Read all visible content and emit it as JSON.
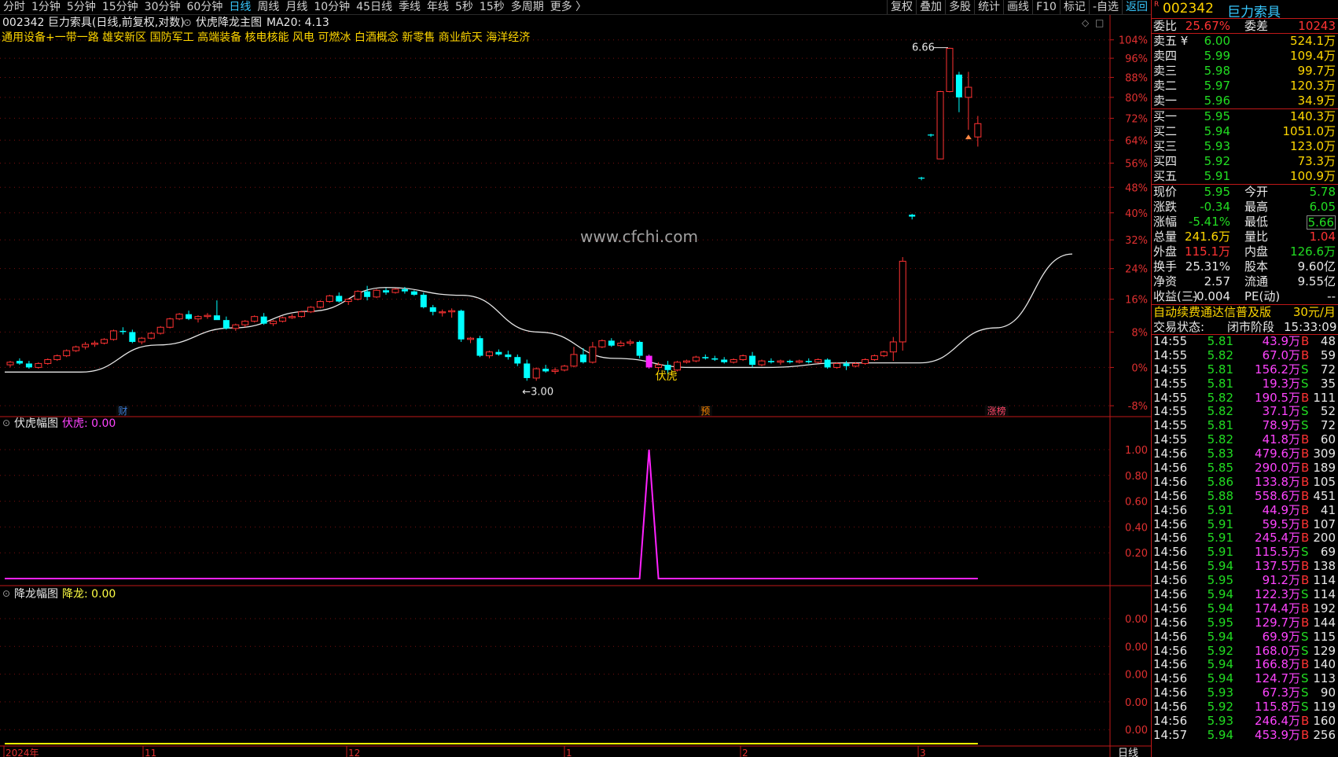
{
  "toolbar": {
    "periods": [
      "分时",
      "1分钟",
      "5分钟",
      "15分钟",
      "30分钟",
      "60分钟",
      "日线",
      "周线",
      "月线",
      "10分钟",
      "45日线",
      "季线",
      "年线",
      "5秒",
      "15秒",
      "多周期",
      "更多 〉"
    ],
    "active_period": "日线",
    "tools": [
      "复权",
      "叠加",
      "多股",
      "统计",
      "画线",
      "F10",
      "标记",
      "-自选",
      "返回"
    ]
  },
  "main_chart": {
    "title": "002342 巨力索具(日线,前复权,对数)",
    "indicator_name": "伏虎降龙主图",
    "ma_text": "MA20: 4.13",
    "concepts": "通用设备+一带一路 雄安新区 国防军工 高端装备 核电核能 风电 可燃冰 白酒概念 新零售 商业航天 海洋经济",
    "watermark": "www.cfchi.com",
    "annotations": {
      "high": "6.66",
      "low": "3.00",
      "signal": "伏虎"
    },
    "markers": [
      "财",
      "预",
      "涨榜"
    ],
    "y_ticks": [
      "104%",
      "96%",
      "88%",
      "80%",
      "72%",
      "64%",
      "56%",
      "48%",
      "40%",
      "32%",
      "24%",
      "16%",
      "8%",
      "0%",
      "-8%"
    ]
  },
  "sub_chart_1": {
    "title": "伏虎幅图",
    "value_text": "伏虎: 0.00",
    "y_ticks": [
      "1.00",
      "0.80",
      "0.60",
      "0.40",
      "0.20"
    ]
  },
  "sub_chart_2": {
    "title": "降龙幅图",
    "value_text": "降龙: 0.00",
    "y_ticks": [
      "0.00",
      "0.00",
      "0.00",
      "0.00",
      "0.00"
    ]
  },
  "time_axis": {
    "labels": [
      "2024年",
      "11",
      "12",
      "1",
      "2",
      "3"
    ],
    "unit": "日线"
  },
  "chart_data": {
    "type": "candlestick",
    "scale": "log",
    "pct_base": 3.5,
    "y_range_pct": [
      -10,
      106
    ],
    "candles": [
      [
        3.52,
        3.55,
        3.5,
        3.54
      ],
      [
        3.55,
        3.57,
        3.52,
        3.53
      ],
      [
        3.53,
        3.55,
        3.49,
        3.5
      ],
      [
        3.5,
        3.54,
        3.49,
        3.53
      ],
      [
        3.53,
        3.57,
        3.52,
        3.56
      ],
      [
        3.56,
        3.6,
        3.55,
        3.59
      ],
      [
        3.59,
        3.64,
        3.58,
        3.63
      ],
      [
        3.63,
        3.67,
        3.62,
        3.66
      ],
      [
        3.66,
        3.7,
        3.64,
        3.68
      ],
      [
        3.68,
        3.71,
        3.66,
        3.69
      ],
      [
        3.69,
        3.73,
        3.68,
        3.72
      ],
      [
        3.72,
        3.8,
        3.71,
        3.79
      ],
      [
        3.79,
        3.82,
        3.76,
        3.78
      ],
      [
        3.78,
        3.8,
        3.69,
        3.7
      ],
      [
        3.7,
        3.74,
        3.68,
        3.73
      ],
      [
        3.73,
        3.78,
        3.72,
        3.77
      ],
      [
        3.77,
        3.83,
        3.76,
        3.82
      ],
      [
        3.82,
        3.9,
        3.81,
        3.89
      ],
      [
        3.89,
        3.94,
        3.88,
        3.93
      ],
      [
        3.93,
        3.96,
        3.88,
        3.89
      ],
      [
        3.89,
        3.92,
        3.86,
        3.91
      ],
      [
        3.91,
        3.94,
        3.89,
        3.92
      ],
      [
        3.92,
        4.05,
        3.91,
        3.88
      ],
      [
        3.88,
        3.91,
        3.8,
        3.81
      ],
      [
        3.81,
        3.85,
        3.79,
        3.84
      ],
      [
        3.84,
        3.88,
        3.82,
        3.87
      ],
      [
        3.87,
        3.92,
        3.86,
        3.91
      ],
      [
        3.91,
        3.94,
        3.84,
        3.85
      ],
      [
        3.85,
        3.88,
        3.83,
        3.87
      ],
      [
        3.87,
        3.91,
        3.86,
        3.9
      ],
      [
        3.9,
        3.93,
        3.89,
        3.91
      ],
      [
        3.91,
        3.96,
        3.9,
        3.95
      ],
      [
        3.95,
        4.0,
        3.94,
        3.99
      ],
      [
        3.99,
        4.05,
        3.98,
        4.04
      ],
      [
        4.04,
        4.1,
        4.03,
        4.09
      ],
      [
        4.09,
        4.12,
        4.03,
        4.04
      ],
      [
        4.04,
        4.07,
        4.01,
        4.06
      ],
      [
        4.06,
        4.14,
        4.05,
        4.13
      ],
      [
        4.13,
        4.18,
        4.05,
        4.08
      ],
      [
        4.08,
        4.15,
        4.07,
        4.14
      ],
      [
        4.14,
        4.16,
        4.1,
        4.12
      ],
      [
        4.12,
        4.16,
        4.11,
        4.15
      ],
      [
        4.15,
        4.17,
        4.11,
        4.13
      ],
      [
        4.13,
        4.14,
        4.09,
        4.1
      ],
      [
        4.1,
        4.12,
        3.98,
        3.99
      ],
      [
        3.99,
        4.01,
        3.92,
        3.95
      ],
      [
        3.95,
        3.97,
        3.91,
        3.95
      ],
      [
        3.95,
        3.98,
        3.9,
        3.96
      ],
      [
        3.96,
        3.97,
        3.7,
        3.72
      ],
      [
        3.72,
        3.74,
        3.69,
        3.73
      ],
      [
        3.73,
        3.75,
        3.58,
        3.59
      ],
      [
        3.59,
        3.63,
        3.57,
        3.62
      ],
      [
        3.62,
        3.64,
        3.59,
        3.6
      ],
      [
        3.6,
        3.63,
        3.56,
        3.58
      ],
      [
        3.58,
        3.6,
        3.51,
        3.53
      ],
      [
        3.53,
        3.56,
        3.4,
        3.42
      ],
      [
        3.42,
        3.5,
        3.4,
        3.49
      ],
      [
        3.49,
        3.52,
        3.46,
        3.47
      ],
      [
        3.47,
        3.5,
        3.45,
        3.48
      ],
      [
        3.48,
        3.52,
        3.47,
        3.51
      ],
      [
        3.51,
        3.66,
        3.5,
        3.6
      ],
      [
        3.6,
        3.65,
        3.53,
        3.54
      ],
      [
        3.54,
        3.7,
        3.53,
        3.66
      ],
      [
        3.66,
        3.72,
        3.65,
        3.71
      ],
      [
        3.71,
        3.73,
        3.66,
        3.67
      ],
      [
        3.67,
        3.71,
        3.66,
        3.69
      ],
      [
        3.69,
        3.72,
        3.67,
        3.7
      ],
      [
        3.7,
        3.71,
        3.57,
        3.59
      ],
      [
        3.59,
        3.6,
        3.49,
        3.5
      ],
      [
        3.5,
        3.54,
        3.48,
        3.52
      ],
      [
        3.52,
        3.55,
        3.45,
        3.48
      ],
      [
        3.48,
        3.55,
        3.47,
        3.54
      ],
      [
        3.54,
        3.56,
        3.53,
        3.55
      ],
      [
        3.55,
        3.59,
        3.54,
        3.58
      ],
      [
        3.58,
        3.6,
        3.56,
        3.57
      ],
      [
        3.57,
        3.59,
        3.55,
        3.56
      ],
      [
        3.56,
        3.58,
        3.53,
        3.54
      ],
      [
        3.54,
        3.57,
        3.53,
        3.56
      ],
      [
        3.56,
        3.6,
        3.55,
        3.59
      ],
      [
        3.59,
        3.62,
        3.5,
        3.52
      ],
      [
        3.52,
        3.56,
        3.51,
        3.55
      ],
      [
        3.55,
        3.57,
        3.53,
        3.54
      ],
      [
        3.54,
        3.56,
        3.52,
        3.55
      ],
      [
        3.55,
        3.56,
        3.53,
        3.54
      ],
      [
        3.54,
        3.56,
        3.53,
        3.55
      ],
      [
        3.55,
        3.57,
        3.53,
        3.54
      ],
      [
        3.54,
        3.57,
        3.53,
        3.56
      ],
      [
        3.56,
        3.57,
        3.49,
        3.5
      ],
      [
        3.5,
        3.54,
        3.49,
        3.53
      ],
      [
        3.53,
        3.55,
        3.48,
        3.51
      ],
      [
        3.51,
        3.54,
        3.5,
        3.53
      ],
      [
        3.53,
        3.57,
        3.52,
        3.56
      ],
      [
        3.56,
        3.6,
        3.55,
        3.59
      ],
      [
        3.59,
        3.63,
        3.58,
        3.62
      ],
      [
        3.62,
        3.74,
        3.55,
        3.7
      ],
      [
        3.7,
        4.45,
        3.63,
        4.41
      ],
      [
        4.88,
        4.89,
        4.83,
        4.86
      ],
      [
        5.29,
        5.3,
        5.26,
        5.28
      ],
      [
        5.81,
        5.82,
        5.78,
        5.8
      ],
      [
        5.51,
        6.39,
        5.51,
        6.38
      ],
      [
        6.38,
        7.02,
        6.37,
        7.01
      ],
      [
        6.62,
        6.66,
        6.1,
        6.3
      ],
      [
        6.3,
        6.66,
        5.87,
        6.44
      ],
      [
        5.78,
        6.05,
        5.66,
        5.95
      ]
    ],
    "ma20_level_pct": [
      -1,
      -1,
      5,
      9,
      13,
      19,
      17,
      8,
      2,
      0,
      0,
      1,
      1,
      9,
      28
    ],
    "fuhu_signal": {
      "index": 68,
      "value": 1.0,
      "baseline": 0.0
    },
    "jianglong_value": 0.0
  },
  "quote_panel": {
    "code": "002342",
    "name": "巨力索具",
    "badge": "R",
    "weibi_label": "委比",
    "weibi_value": "25.67%",
    "weicha_label": "委差",
    "weicha_value": "10243",
    "asks": [
      {
        "label": "卖五 ¥",
        "price": "6.00",
        "vol": "524.1万"
      },
      {
        "label": "卖四",
        "price": "5.99",
        "vol": "109.4万"
      },
      {
        "label": "卖三",
        "price": "5.98",
        "vol": "99.7万"
      },
      {
        "label": "卖二",
        "price": "5.97",
        "vol": "120.3万"
      },
      {
        "label": "卖一",
        "price": "5.96",
        "vol": "34.9万"
      }
    ],
    "bids": [
      {
        "label": "买一",
        "price": "5.95",
        "vol": "140.3万"
      },
      {
        "label": "买二",
        "price": "5.94",
        "vol": "1051.0万"
      },
      {
        "label": "买三",
        "price": "5.93",
        "vol": "123.0万"
      },
      {
        "label": "买四",
        "price": "5.92",
        "vol": "73.3万"
      },
      {
        "label": "买五",
        "price": "5.91",
        "vol": "100.9万"
      }
    ],
    "stats": [
      {
        "l1": "现价",
        "v1": "5.95",
        "c1": "g",
        "l2": "今开",
        "v2": "5.78",
        "c2": "g"
      },
      {
        "l1": "涨跌",
        "v1": "-0.34",
        "c1": "g",
        "l2": "最高",
        "v2": "6.05",
        "c2": "g"
      },
      {
        "l1": "涨幅",
        "v1": "-5.41%",
        "c1": "g",
        "l2": "最低",
        "v2": "5.66",
        "c2": "g"
      },
      {
        "l1": "总量",
        "v1": "241.6万",
        "c1": "y",
        "l2": "量比",
        "v2": "1.04",
        "c2": "r"
      },
      {
        "l1": "外盘",
        "v1": "115.1万",
        "c1": "r",
        "l2": "内盘",
        "v2": "126.6万",
        "c2": "g"
      },
      {
        "l1": "换手",
        "v1": "25.31%",
        "c1": "w",
        "l2": "股本",
        "v2": "9.60亿",
        "c2": "w"
      },
      {
        "l1": "净资",
        "v1": "2.57",
        "c1": "w",
        "l2": "流通",
        "v2": "9.55亿",
        "c2": "w"
      },
      {
        "l1": "收益(三)",
        "v1": "-0.004",
        "c1": "w",
        "l2": "PE(动)",
        "v2": "--",
        "c2": "w"
      }
    ],
    "ad_text": "自动续费通达信普及版",
    "ad_price": "30元/月",
    "status_label": "交易状态:",
    "status_value": "闭市阶段",
    "status_time": "15:33:09",
    "ticks": [
      [
        "14:55",
        "5.81",
        "43.9万",
        "B",
        "48"
      ],
      [
        "14:55",
        "5.82",
        "67.0万",
        "B",
        "59"
      ],
      [
        "14:55",
        "5.81",
        "156.2万",
        "S",
        "72"
      ],
      [
        "14:55",
        "5.81",
        "19.3万",
        "S",
        "35"
      ],
      [
        "14:55",
        "5.82",
        "190.5万",
        "B",
        "111"
      ],
      [
        "14:55",
        "5.82",
        "37.1万",
        "S",
        "52"
      ],
      [
        "14:55",
        "5.81",
        "78.9万",
        "S",
        "72"
      ],
      [
        "14:55",
        "5.82",
        "41.8万",
        "B",
        "60"
      ],
      [
        "14:56",
        "5.83",
        "479.6万",
        "B",
        "309"
      ],
      [
        "14:56",
        "5.85",
        "290.0万",
        "B",
        "189"
      ],
      [
        "14:56",
        "5.86",
        "133.8万",
        "B",
        "105"
      ],
      [
        "14:56",
        "5.88",
        "558.6万",
        "B",
        "451"
      ],
      [
        "14:56",
        "5.91",
        "44.9万",
        "B",
        "41"
      ],
      [
        "14:56",
        "5.91",
        "59.5万",
        "B",
        "107"
      ],
      [
        "14:56",
        "5.91",
        "245.4万",
        "B",
        "200"
      ],
      [
        "14:56",
        "5.91",
        "115.5万",
        "S",
        "69"
      ],
      [
        "14:56",
        "5.94",
        "137.5万",
        "B",
        "138"
      ],
      [
        "14:56",
        "5.95",
        "91.2万",
        "B",
        "114"
      ],
      [
        "14:56",
        "5.94",
        "122.3万",
        "S",
        "114"
      ],
      [
        "14:56",
        "5.94",
        "174.4万",
        "B",
        "192"
      ],
      [
        "14:56",
        "5.95",
        "129.7万",
        "B",
        "144"
      ],
      [
        "14:56",
        "5.94",
        "69.9万",
        "S",
        "115"
      ],
      [
        "14:56",
        "5.92",
        "168.0万",
        "S",
        "129"
      ],
      [
        "14:56",
        "5.94",
        "166.8万",
        "B",
        "140"
      ],
      [
        "14:56",
        "5.94",
        "124.7万",
        "S",
        "113"
      ],
      [
        "14:56",
        "5.93",
        "67.3万",
        "S",
        "90"
      ],
      [
        "14:56",
        "5.92",
        "115.8万",
        "S",
        "119"
      ],
      [
        "14:56",
        "5.93",
        "246.4万",
        "B",
        "160"
      ],
      [
        "14:57",
        "5.94",
        "453.9万",
        "B",
        "256"
      ]
    ]
  },
  "colors": {
    "up": "#ff3232",
    "down": "#00ffff",
    "ma20": "#e6e6e6",
    "fuhu": "#ff22ff",
    "jianglong": "#ffff00",
    "axis": "#c01818",
    "bid_green": "#22dd22",
    "accent": "#38c8ff"
  }
}
